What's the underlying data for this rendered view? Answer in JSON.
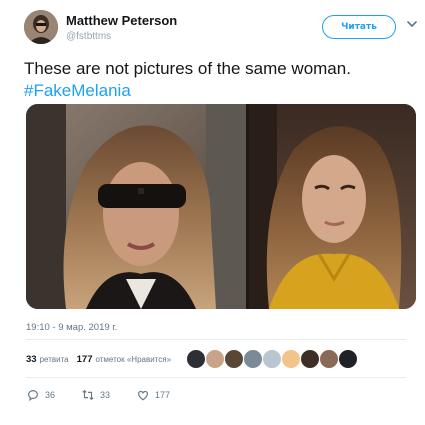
{
  "author": {
    "display_name": "Matthew Peterson",
    "handle": "@fstbttms",
    "follow_label": "Читать"
  },
  "tweet": {
    "text": "These are not pictures of the same woman.",
    "hashtag": "#FakeMelania",
    "timestamp": "19:10 - 9 мар. 2019 г."
  },
  "stats": {
    "retweets_count": "33",
    "retweets_label": "ретвита",
    "likes_count": "177",
    "likes_label": "отметок «Нравится»",
    "liker_avatar_colors": [
      "#2c2f33",
      "#c9a48a",
      "#5a4635",
      "#7c8a97",
      "#b9c6d1",
      "#f2c38b",
      "#3e2f26",
      "#8a6a54",
      "#1f2226"
    ]
  },
  "actions": {
    "replies": "36",
    "retweets": "33",
    "likes": "177"
  },
  "colors": {
    "accent": "#1da1f2",
    "secondary_text": "#657786",
    "divider": "#e6ecf0"
  }
}
